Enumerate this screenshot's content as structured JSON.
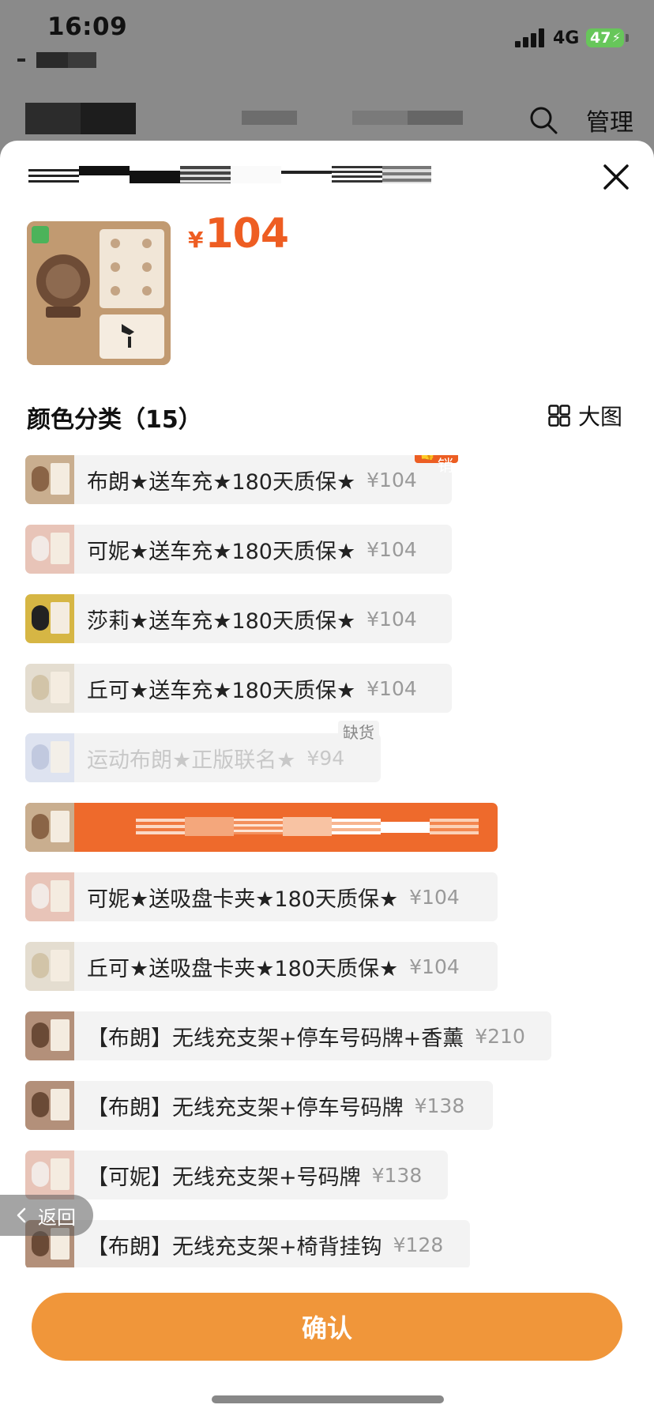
{
  "status_bar": {
    "time": "16:09",
    "network": "4G",
    "battery_level": "47"
  },
  "header": {
    "manage_label": "管理"
  },
  "product": {
    "price_symbol": "¥",
    "price": "104"
  },
  "section": {
    "title": "颜色分类（15）",
    "big_pic_label": "大图"
  },
  "options": [
    {
      "label": "布朗★送车充★180天质保★",
      "price": "¥104",
      "badge": "畅销",
      "color": "#8a6446"
    },
    {
      "label": "可妮★送车充★180天质保★",
      "price": "¥104",
      "color": "#e6d9d2"
    },
    {
      "label": "莎莉★送车充★180天质保★",
      "price": "¥104",
      "color": "#2c2c2c"
    },
    {
      "label": "丘可★送车充★180天质保★",
      "price": "¥104",
      "color": "#d9cfbd"
    },
    {
      "label": "运动布朗★正版联名★",
      "price": "¥94",
      "badge": "缺货",
      "color": "#c8cfe4"
    },
    {
      "label": "",
      "price": "",
      "color": "#8a6446"
    },
    {
      "label": "可妮★送吸盘卡夹★180天质保★",
      "price": "¥104",
      "color": "#e6d9d2"
    },
    {
      "label": "丘可★送吸盘卡夹★180天质保★",
      "price": "¥104",
      "color": "#d9cfbd"
    },
    {
      "label": "【布朗】无线充支架+停车号码牌+香薰",
      "price": "¥210",
      "color": "#7a5a40"
    },
    {
      "label": "【布朗】无线充支架+停车号码牌",
      "price": "¥138",
      "color": "#7a5a40"
    },
    {
      "label": "【可妮】无线充支架+号码牌",
      "price": "¥138",
      "color": "#e6d9d2"
    },
    {
      "label": "【布朗】无线充支架+椅背挂钩",
      "price": "¥128",
      "color": "#7a5a40"
    }
  ],
  "back_label": "返回",
  "confirm_label": "确认",
  "colors": {
    "accent": "#ee6a2c",
    "price": "#ee5d22",
    "confirm": "#f0963a"
  }
}
